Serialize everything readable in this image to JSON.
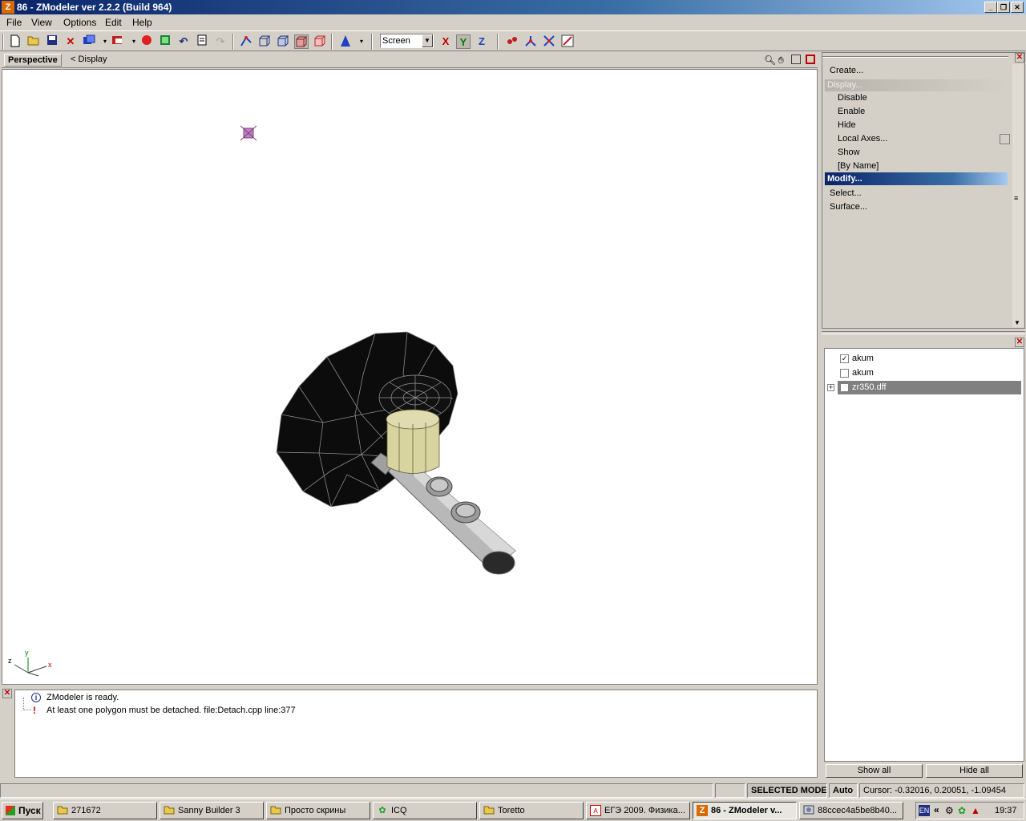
{
  "window": {
    "title": "86 - ZModeler ver 2.2.2 (Build 964)",
    "app_icon": "Z",
    "minimize": "_",
    "restore": "❐",
    "close": "✕"
  },
  "menu": {
    "items": [
      "File",
      "View",
      "Options",
      "Edit",
      "Help"
    ]
  },
  "toolbar": {
    "coord_mode": "Screen",
    "axis_x": "X",
    "axis_y": "Y",
    "axis_z": "Z"
  },
  "viewport": {
    "name": "Perspective",
    "mode_label": "<  Display",
    "axes": {
      "z": "z",
      "y": "y",
      "x": "x"
    }
  },
  "command_panel": {
    "create": "Create...",
    "display": "Display...",
    "display_items": [
      "Disable",
      "Enable",
      "Hide",
      "Local Axes...",
      "Show",
      "[By Name]"
    ],
    "modify": "Modify...",
    "select": "Select...",
    "surface": "Surface..."
  },
  "object_tree": {
    "items": [
      {
        "label": "akum",
        "checked": true
      },
      {
        "label": "akum",
        "checked": false
      },
      {
        "label": "zr350.dff",
        "checked": false,
        "expandable": true
      }
    ],
    "show_all": "Show all",
    "hide_all": "Hide all"
  },
  "log": {
    "entries": [
      {
        "type": "info",
        "text": "ZModeler is ready."
      },
      {
        "type": "warning",
        "text": "At least one polygon must be detached. file:Detach.cpp line:377"
      }
    ]
  },
  "status": {
    "mode": "SELECTED MODE",
    "auto": "Auto",
    "cursor": "Cursor: -0.32016, 0.20051, -1.09454"
  },
  "taskbar": {
    "start": "Пуск",
    "tasks": [
      {
        "label": "271672",
        "icon": "folder-icon"
      },
      {
        "label": "Sanny Builder 3",
        "icon": "folder-icon"
      },
      {
        "label": "Просто скрины",
        "icon": "folder-icon"
      },
      {
        "label": "ICQ",
        "icon": "icq-icon"
      },
      {
        "label": "Toretto",
        "icon": "folder-icon"
      },
      {
        "label": "ЕГЭ 2009. Физика...",
        "icon": "pdf-icon"
      },
      {
        "label": "86 - ZModeler v...",
        "icon": "zmodeler-icon",
        "active": true
      },
      {
        "label": "88ccec4a5be8b40...",
        "icon": "image-icon"
      }
    ],
    "lang": "EN",
    "clock": "19:37"
  }
}
